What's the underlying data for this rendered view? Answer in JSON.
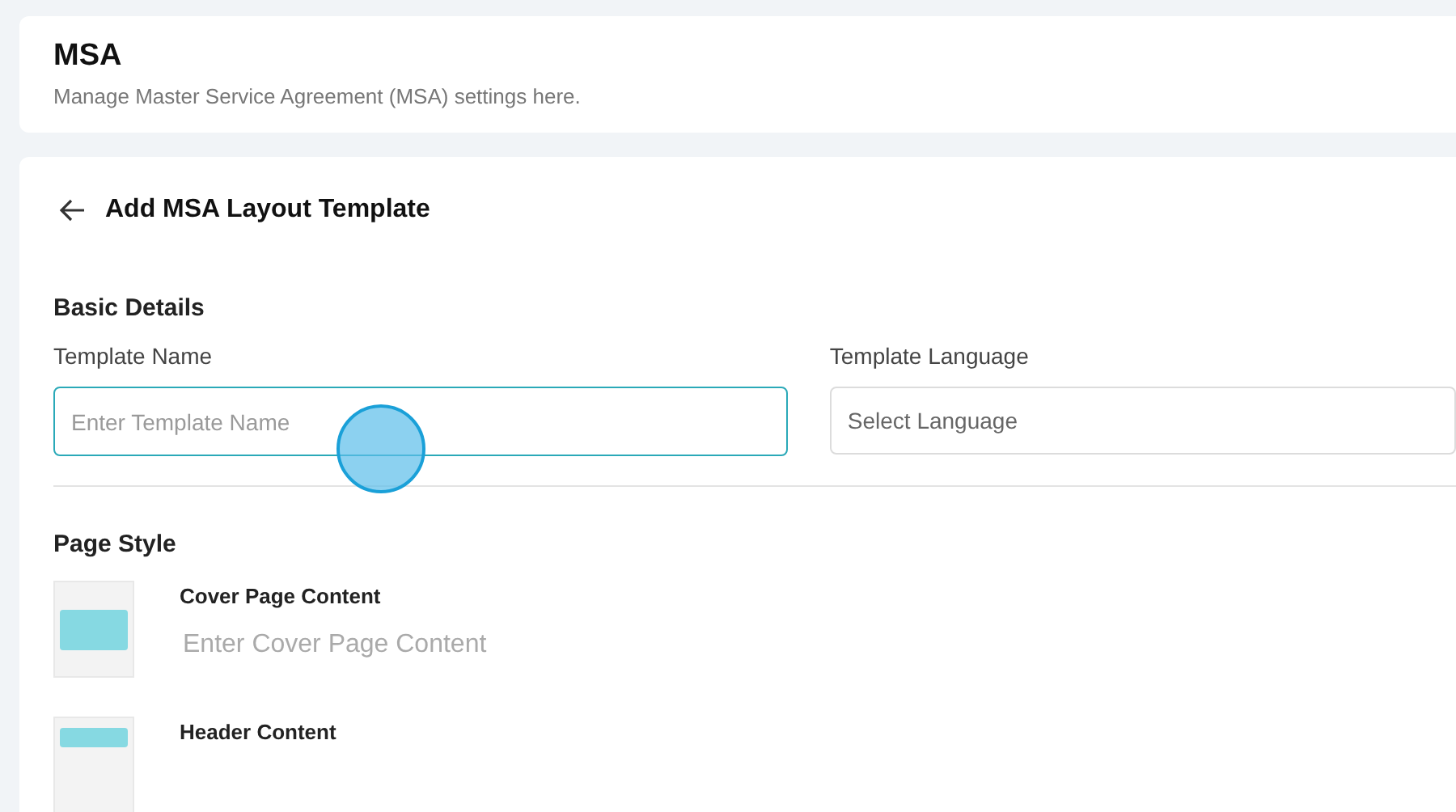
{
  "header": {
    "title": "MSA",
    "subtitle": "Manage Master Service Agreement (MSA) settings here."
  },
  "form": {
    "title": "Add MSA Layout Template",
    "basic_details": {
      "heading": "Basic Details",
      "fields": [
        {
          "kind": "text",
          "label": "Template Name",
          "placeholder": "Enter Template Name",
          "focused": true
        },
        {
          "kind": "select",
          "label": "Template Language",
          "placeholder": "Select Language",
          "focused": false
        }
      ]
    },
    "page_style": {
      "heading": "Page Style",
      "items": [
        {
          "kind": "cover",
          "label": "Cover Page Content",
          "placeholder": "Enter Cover Page Content"
        },
        {
          "kind": "header",
          "label": "Header Content"
        }
      ]
    }
  }
}
